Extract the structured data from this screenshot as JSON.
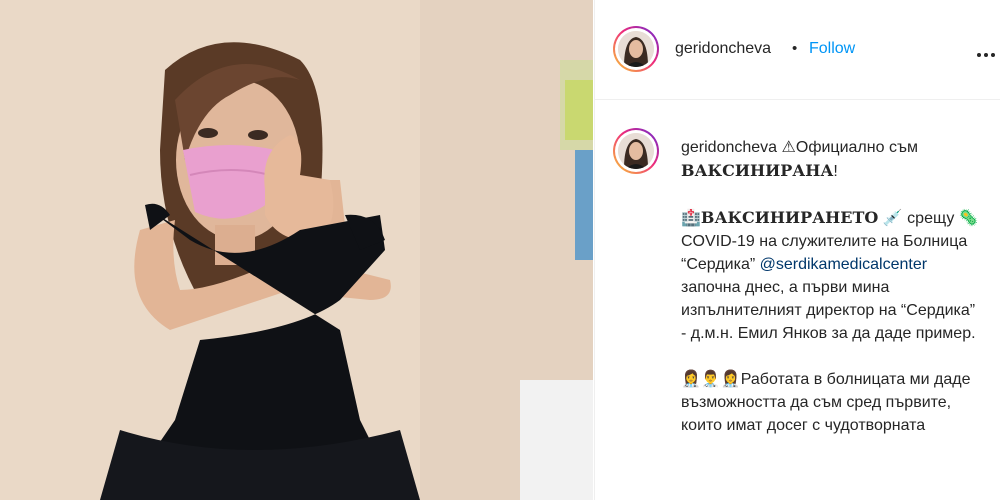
{
  "post": {
    "author": "geridoncheva",
    "separator": "•",
    "follow_label": "Follow",
    "more_icon": "more-options-icon"
  },
  "caption": {
    "author": "geridoncheva",
    "line1_symbol": "⚠",
    "line1_text": "Официално съм",
    "line1_bold": "ВАКСИНИРАНА",
    "line1_end": "!",
    "p2_symbol": "🏥",
    "p2_bold": "ВАКСИНИРАНЕТО",
    "p2_symbol2": "💉",
    "p2_text1": "срещу",
    "p2_symbol3": "🦠",
    "p2_text2": "COVID-19 на служителите на Болница “Сердика”",
    "p2_mention": "@serdikamedicalcenter",
    "p2_text3": "започна днес, а първи мина изпълнителният директор на “Сердика” - д.м.н. Емил Янков за да даде пример.",
    "p3_symbols": "👩‍⚕️👨‍⚕️👩‍⚕️",
    "p3_text": "Работата в болницата ми даде възможността да съм сред първите, които имат досег с чудотворната"
  },
  "colors": {
    "link_blue": "#0095f6",
    "mention_blue": "#00376b",
    "text": "#262626",
    "dress": "#0f1115",
    "mask": "#e9a0cf"
  }
}
